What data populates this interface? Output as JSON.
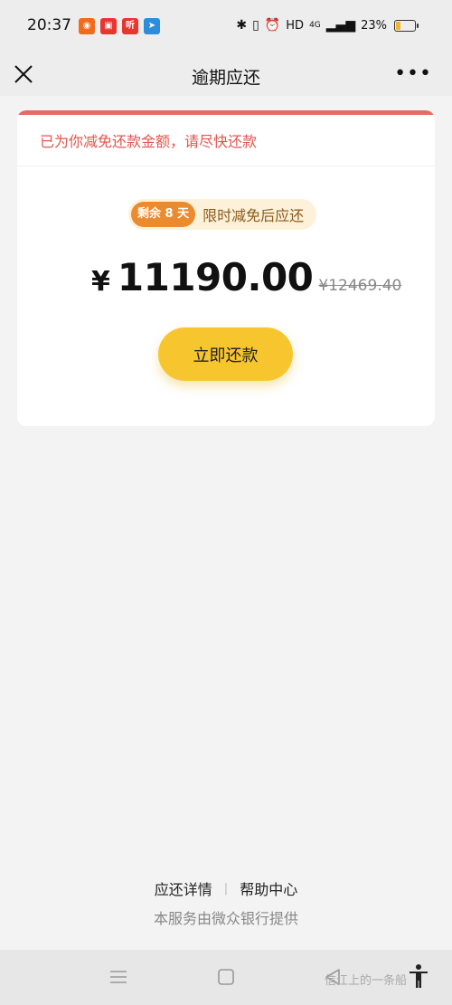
{
  "status_bar": {
    "time": "20:37",
    "notifications": [
      {
        "icon": "app-notification-icon",
        "label": "",
        "color": "#f26b1d"
      },
      {
        "icon": "shopping-app-icon",
        "label": "",
        "color": "#e8352d"
      },
      {
        "icon": "listen-app-icon",
        "label": "听",
        "color": "#e8352d"
      },
      {
        "icon": "navigation-app-icon",
        "label": "",
        "color": "#2e8ddb"
      }
    ],
    "hd": "HD",
    "network": "4G",
    "battery_percent": "23%",
    "battery_level": 0.23
  },
  "nav": {
    "title": "逾期应还"
  },
  "card": {
    "notice": "已为你减免还款金额，请尽快还款",
    "pill_badge": "剩余 8 天",
    "pill_text": "限时减免后应还",
    "currency": "¥",
    "amount": "11190.00",
    "original_amount": "¥12469.40",
    "button_label": "立即还款"
  },
  "footer": {
    "link_details": "应还详情",
    "separator": "|",
    "link_help": "帮助中心",
    "service_text": "本服务由微众银行提供"
  },
  "watermark": "信江上的一条船",
  "colors": {
    "accent_red": "#e2564d",
    "button_yellow": "#f7c62f",
    "badge_orange": "#ec8a2e"
  }
}
